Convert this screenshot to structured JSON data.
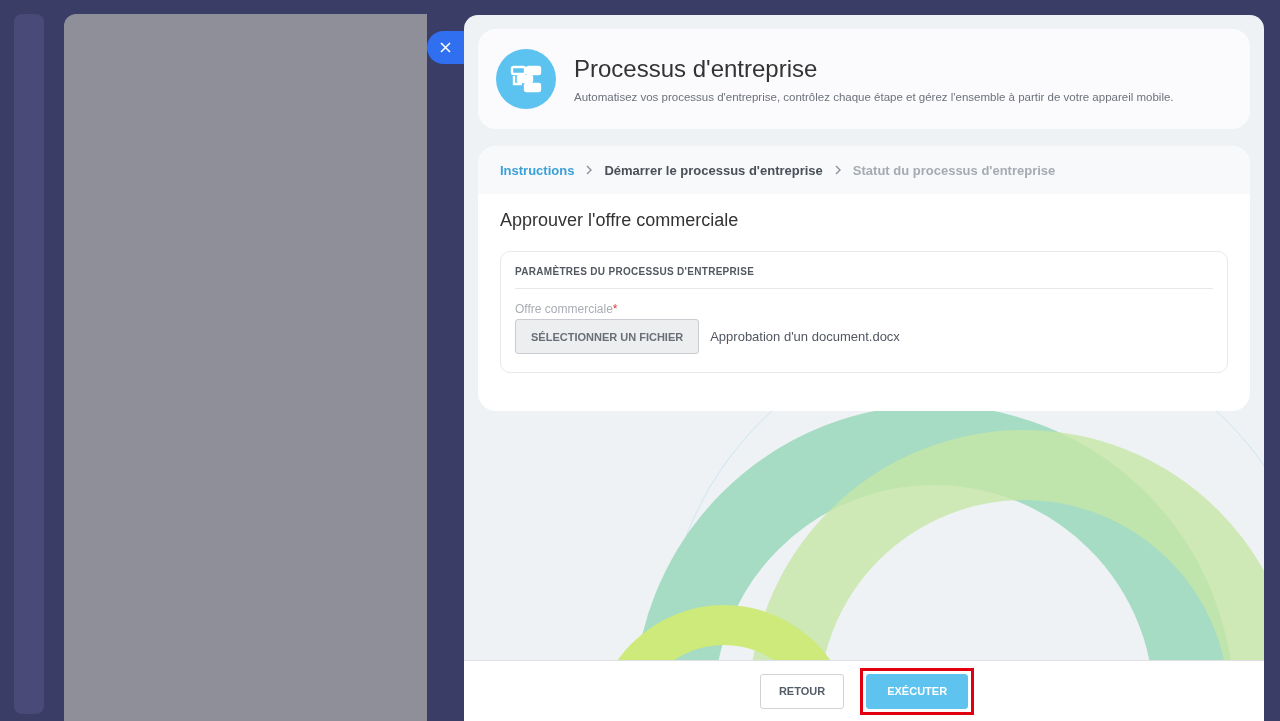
{
  "header": {
    "title": "Processus d'entreprise",
    "subtitle": "Automatisez vos processus d'entreprise, contrôlez chaque étape et gérez l'ensemble à partir de votre appareil mobile."
  },
  "steps": [
    {
      "label": "Instructions",
      "completed": true,
      "selected": false
    },
    {
      "label": "Démarrer le processus d'entreprise",
      "completed": false,
      "selected": true
    },
    {
      "label": "Statut du processus d'entreprise",
      "completed": false,
      "selected": false
    }
  ],
  "form": {
    "title": "Approuver l'offre commerciale",
    "section_title": "PARAMÈTRES DU PROCESSUS D'ENTREPRISE",
    "field_label": "Offre commerciale",
    "required_mark": "*",
    "file_button": "SÉLECTIONNER UN FICHIER",
    "file_name": "Approbation d'un document.docx"
  },
  "footer": {
    "buttons": [
      {
        "label": "RETOUR",
        "kind": "secondary",
        "highlighted": false
      },
      {
        "label": "EXÉCUTER",
        "kind": "primary",
        "highlighted": true
      }
    ]
  }
}
